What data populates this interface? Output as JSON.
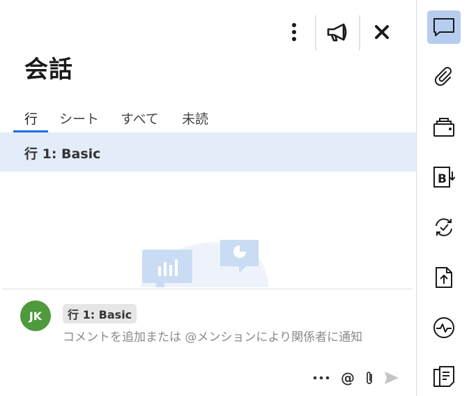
{
  "panel": {
    "title": "会話",
    "tabs": [
      {
        "label": "行",
        "active": true
      },
      {
        "label": "シート",
        "active": false
      },
      {
        "label": "すべて",
        "active": false
      },
      {
        "label": "未読",
        "active": false
      }
    ],
    "row_header": "行 1: Basic",
    "top_icons": [
      "more-vertical-icon",
      "megaphone-icon",
      "close-icon"
    ]
  },
  "composer": {
    "avatar_initials": "JK",
    "avatar_color": "#4f9a3c",
    "reference_chip": "行 1: Basic",
    "placeholder": "コメントを追加または @メンションにより関係者に通知",
    "mention_symbol": "@",
    "icons": [
      "more-horizontal-icon",
      "at-mention-icon",
      "paperclip-icon",
      "send-icon"
    ]
  },
  "rail": {
    "items": [
      {
        "name": "conversations-icon",
        "active": true
      },
      {
        "name": "attachments-icon",
        "active": false
      },
      {
        "name": "proofing-icon",
        "active": false
      },
      {
        "name": "summary-icon",
        "active": false
      },
      {
        "name": "update-requests-icon",
        "active": false
      },
      {
        "name": "publish-icon",
        "active": false
      },
      {
        "name": "activity-log-icon",
        "active": false
      },
      {
        "name": "sheet-summary-report-icon",
        "active": false
      }
    ]
  },
  "colors": {
    "accent": "#1e6fd9",
    "row_highlight": "#e3edfa",
    "rail_active": "#b6cdf0"
  }
}
